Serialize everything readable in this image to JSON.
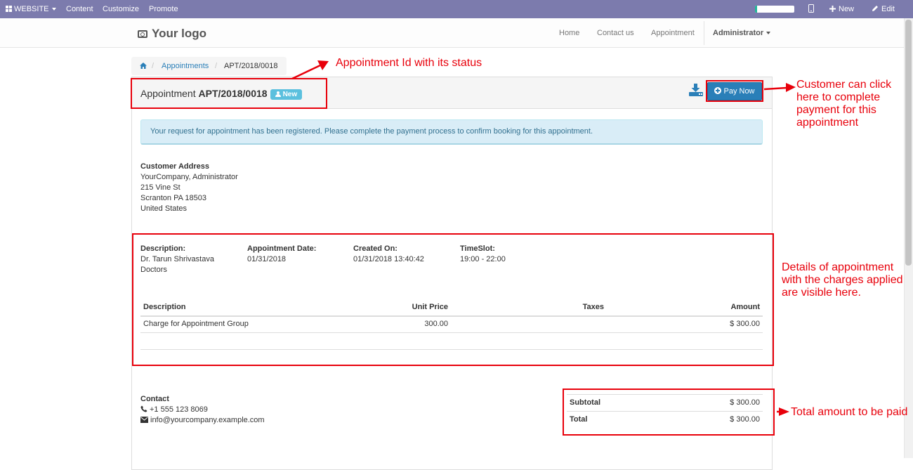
{
  "topbar": {
    "website_label": "WEBSITE",
    "content_label": "Content",
    "customize_label": "Customize",
    "promote_label": "Promote",
    "new_label": "New",
    "edit_label": "Edit",
    "progress_fraction": 0.05
  },
  "header": {
    "logo_text": "Your logo",
    "nav": [
      "Home",
      "Contact us",
      "Appointment"
    ],
    "user_label": "Administrator"
  },
  "breadcrumb": {
    "appointments": "Appointments",
    "current": "APT/2018/0018"
  },
  "panel": {
    "title_prefix": "Appointment",
    "appointment_id": "APT/2018/0018",
    "status": "New",
    "pay_label": "Pay Now",
    "alert": "Your request for appointment has been registered. Please complete the payment process to confirm booking for this appointment."
  },
  "address": {
    "heading": "Customer Address",
    "lines": [
      "YourCompany, Administrator",
      "215 Vine St",
      "Scranton PA 18503",
      "United States"
    ]
  },
  "details": {
    "description_label": "Description:",
    "description_value1": "Dr. Tarun Shrivastava",
    "description_value2": "Doctors",
    "date_label": "Appointment Date:",
    "date_value": "01/31/2018",
    "created_label": "Created On:",
    "created_value": "01/31/2018 13:40:42",
    "timeslot_label": "TimeSlot:",
    "timeslot_value": "19:00 - 22:00"
  },
  "lines_table": {
    "headers": [
      "Description",
      "Unit Price",
      "Taxes",
      "Amount"
    ],
    "rows": [
      [
        "Charge for Appointment Group",
        "300.00",
        "",
        "$ 300.00"
      ]
    ]
  },
  "contact": {
    "heading": "Contact",
    "phone": "+1 555 123 8069",
    "email": "info@yourcompany.example.com"
  },
  "totals": {
    "subtotal_label": "Subtotal",
    "subtotal_value": "$ 300.00",
    "total_label": "Total",
    "total_value": "$ 300.00"
  },
  "annotations": {
    "id_status": "Appointment Id with its status",
    "pay": [
      "Customer can click",
      "here to complete",
      "payment for this",
      "appointment"
    ],
    "details": [
      "Details of appointment",
      "with the charges applied",
      "are visible here."
    ],
    "total": "Total amount to be paid"
  },
  "colors": {
    "admin_bar": "#7c7bad",
    "link": "#2a7fb8",
    "badge": "#5bc0de",
    "annotation": "#e8000b"
  }
}
